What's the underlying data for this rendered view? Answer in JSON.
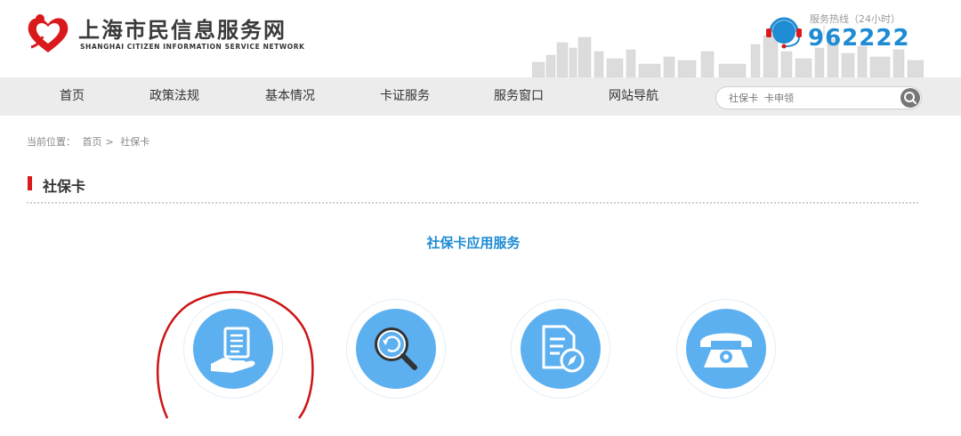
{
  "header": {
    "title": "上海市民信息服务网",
    "subtitle": "SHANGHAI CITIZEN INFORMATION SERVICE NETWORK",
    "hotline_label": "服务热线（24小时）",
    "hotline_number": "962222"
  },
  "nav": {
    "items": [
      "首页",
      "政策法规",
      "基本情况",
      "卡证服务",
      "服务窗口",
      "网站导航"
    ]
  },
  "search": {
    "placeholder": "社保卡  卡申领"
  },
  "breadcrumb": {
    "prefix": "当前位置：",
    "home": "首页",
    "separator": ">",
    "current": "社保卡"
  },
  "section": {
    "title": "社保卡"
  },
  "services": {
    "heading": "社保卡应用服务",
    "icons": [
      "card-application-icon",
      "search-refresh-icon",
      "document-compass-icon",
      "telephone-icon"
    ]
  },
  "colors": {
    "accent_blue": "#1e8bd3",
    "icon_blue": "#5db0f0",
    "brand_red": "#d9191c",
    "nav_bg": "#ececec"
  }
}
